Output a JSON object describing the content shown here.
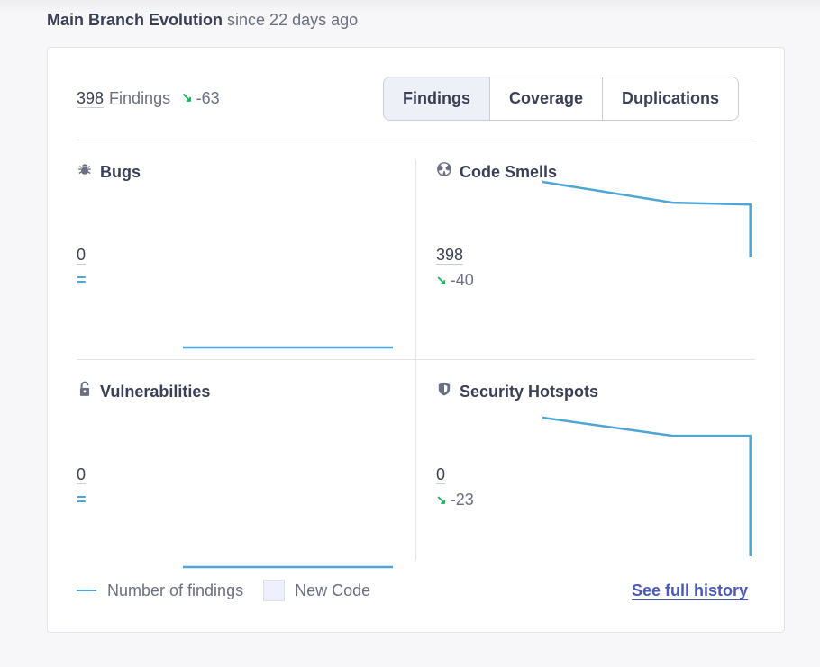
{
  "header": {
    "title": "Main Branch Evolution",
    "subtitle": "since 22 days ago"
  },
  "summary": {
    "count": "398",
    "label": "Findings",
    "delta": "-63"
  },
  "tabs": [
    "Findings",
    "Coverage",
    "Duplications"
  ],
  "selected_tab": "Findings",
  "tiles": {
    "bugs": {
      "title": "Bugs",
      "value": "0",
      "delta": "=",
      "icon": "bug-icon",
      "trend": [
        0,
        0
      ]
    },
    "code_smells": {
      "title": "Code Smells",
      "value": "398",
      "delta": "-40",
      "icon": "code-smells-icon",
      "trend": [
        438,
        427,
        426,
        398
      ]
    },
    "vulnerabilities": {
      "title": "Vulnerabilities",
      "value": "0",
      "delta": "=",
      "icon": "lock-icon",
      "trend": [
        0,
        0
      ]
    },
    "security_hotspots": {
      "title": "Security Hotspots",
      "value": "0",
      "delta": "-23",
      "icon": "shield-icon",
      "trend": [
        23,
        20,
        20,
        0
      ]
    }
  },
  "legend": {
    "series_label": "Number of findings",
    "new_code_label": "New Code"
  },
  "links": {
    "history": "See full history"
  },
  "colors": {
    "line": "#4ea6d6",
    "positive_arrow": "#1cb05c",
    "link": "#4b5ab8"
  }
}
